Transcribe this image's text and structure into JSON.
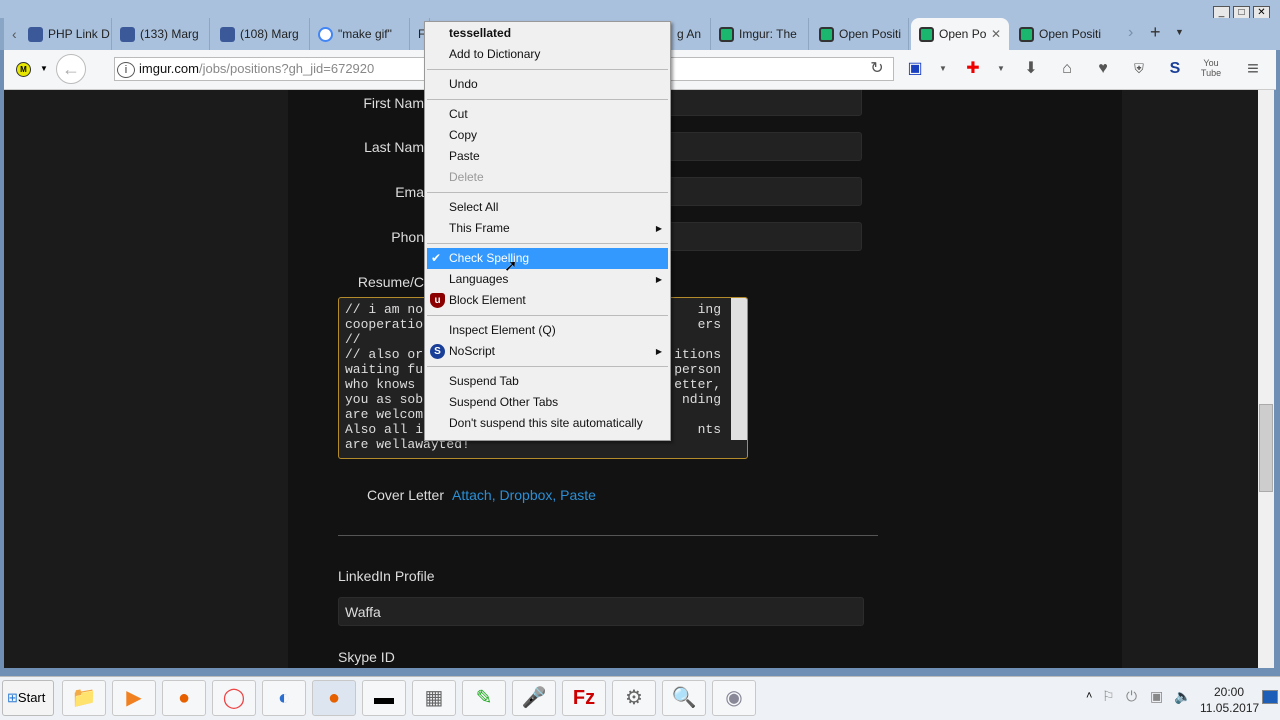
{
  "tabs": [
    {
      "label": "PHP Link D",
      "color": "#3b5998"
    },
    {
      "label": "(133) Marg",
      "color": "#3b5998"
    },
    {
      "label": "(108) Marg",
      "color": "#3b5998"
    },
    {
      "label": "\"make gif\"",
      "color": "#4285f4"
    },
    {
      "label": "F",
      "color": "#888"
    },
    {
      "label": "g An",
      "color": "#888"
    },
    {
      "label": "Imgur: The",
      "color": "#1bb76e"
    },
    {
      "label": "Open Positi",
      "color": "#1bb76e"
    },
    {
      "label": "Open Po",
      "color": "#1bb76e"
    },
    {
      "label": "Open Positi",
      "color": "#1bb76e"
    }
  ],
  "url": {
    "host": "imgur.com",
    "path": "/jobs/positions?gh_jid=672920"
  },
  "form": {
    "first_name": "First Nam",
    "last_name": "Last Nam",
    "email": "Ema",
    "phone": "Phon",
    "resume": "Resume/C",
    "resume_lines": [
      [
        "// i am no",
        "ing"
      ],
      [
        "cooperatio",
        "ers"
      ],
      [
        "//",
        ""
      ],
      [
        "// also or",
        "itions"
      ],
      [
        "waiting fu",
        "person"
      ],
      [
        "who knows",
        "etter,"
      ],
      [
        "you as sob",
        "nding"
      ],
      [
        "are welcom",
        ""
      ],
      [
        "Also all i",
        "nts"
      ],
      [
        "are wellawayted!",
        ""
      ]
    ],
    "cover_letter": "Cover Letter",
    "cover_links": "Attach, Dropbox, Paste",
    "linkedin_label": "LinkedIn Profile",
    "linkedin_value": "Waffa",
    "skype_label": "Skype ID"
  },
  "menu": {
    "word": "tessellated",
    "add": "Add to Dictionary",
    "undo": "Undo",
    "cut": "Cut",
    "copy": "Copy",
    "paste": "Paste",
    "delete": "Delete",
    "select_all": "Select All",
    "this_frame": "This Frame",
    "check_spelling": "Check Spelling",
    "languages": "Languages",
    "block": "Block Element",
    "inspect": "Inspect Element (Q)",
    "noscript": "NoScript",
    "suspend": "Suspend Tab",
    "suspend_other": "Suspend Other Tabs",
    "dont_suspend": "Don't suspend this site automatically"
  },
  "taskbar": {
    "start": "Start",
    "time": "20:00",
    "date": "11.05.2017"
  },
  "colors": {
    "link": "#2a8fd6",
    "highlight": "#3399ff"
  }
}
